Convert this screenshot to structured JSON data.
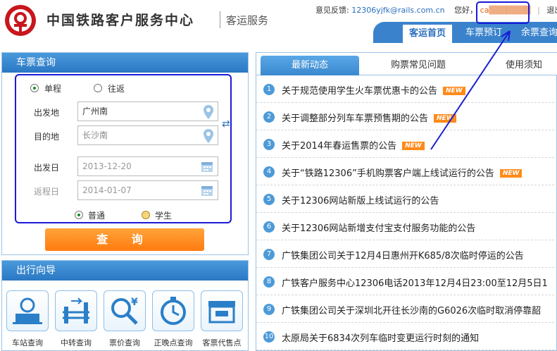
{
  "header": {
    "site_title": "中国铁路客户服务中心",
    "site_subtitle": "客运服务",
    "feedback_label": "意见反馈:",
    "feedback_email": "12306yjfk@rails.com.cn",
    "greeting": "您好，",
    "username": "ca▒▒▒▒▒▒▒",
    "logout": "退出"
  },
  "nav": {
    "items": [
      {
        "label": "客运首页"
      },
      {
        "label": "车票预订"
      },
      {
        "label": "余票查询"
      }
    ]
  },
  "query": {
    "title": "车票查询",
    "trip_types": [
      {
        "label": "单程",
        "selected": true
      },
      {
        "label": "往返",
        "selected": false
      }
    ],
    "from_label": "出发地",
    "from_value": "广州南",
    "to_label": "目的地",
    "to_value": "长沙南",
    "depart_label": "出发日",
    "depart_value": "2013-12-20",
    "return_label": "返程日",
    "return_value": "2014-01-07",
    "passenger_types": [
      {
        "label": "普通",
        "selected": true
      },
      {
        "label": "学生",
        "selected": false
      }
    ],
    "submit_label": "查 询"
  },
  "guide": {
    "title": "出行向导",
    "items": [
      {
        "label": "车站查询",
        "icon": "station-icon"
      },
      {
        "label": "中转查询",
        "icon": "transfer-icon"
      },
      {
        "label": "票价查询",
        "icon": "price-search-icon"
      },
      {
        "label": "正晚点查询",
        "icon": "clock-icon"
      },
      {
        "label": "客票代售点",
        "icon": "ticket-agent-icon"
      }
    ]
  },
  "news": {
    "tabs": [
      {
        "label": "最新动态"
      },
      {
        "label": "购票常见问题"
      },
      {
        "label": "使用须知"
      }
    ],
    "badge": "NEW",
    "items": [
      {
        "num": "1",
        "text": "关于规范使用学生火车票优惠卡的公告",
        "new": true
      },
      {
        "num": "2",
        "text": "关于调整部分列车车票预售期的公告",
        "new": true
      },
      {
        "num": "3",
        "text": "关于2014年春运售票的公告",
        "new": true
      },
      {
        "num": "4",
        "text": "关于“铁路12306”手机购票客户端上线试运行的公告",
        "new": true
      },
      {
        "num": "5",
        "text": "关于12306网站新版上线试运行的公告",
        "new": false
      },
      {
        "num": "6",
        "text": "关于12306网站新增支付宝支付服务功能的公告",
        "new": false
      },
      {
        "num": "7",
        "text": "广铁集团公司关于12月4日惠州开K685/8次临时停运的公告",
        "new": false
      },
      {
        "num": "8",
        "text": "广铁客户服务中心12306电话2013年12月4日23:00至12月5日1",
        "new": false
      },
      {
        "num": "9",
        "text": "广铁集团公司关于深圳北开往长沙南的G6026次临时取消停靠韶",
        "new": false
      },
      {
        "num": "10",
        "text": "太原局关于6834次列车临时变更运行时刻的通知",
        "new": false
      }
    ]
  },
  "colors": {
    "brand_blue": "#3a83cc",
    "accent_orange": "#ff8a1a",
    "annotation_blue": "#1a1ad8",
    "logo_red": "#c8161d"
  }
}
